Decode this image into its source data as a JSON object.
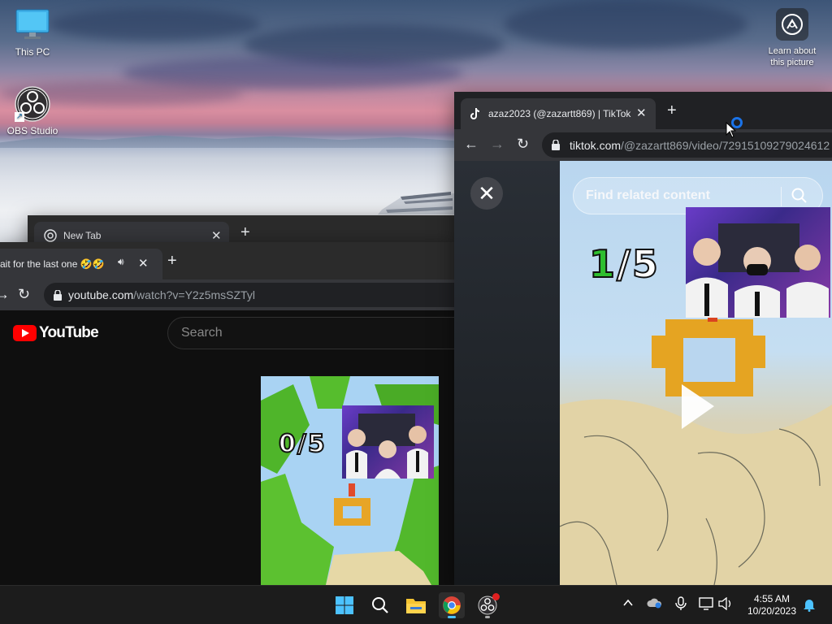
{
  "desktop": {
    "icons": [
      {
        "label": "This PC"
      },
      {
        "label": "OBS Studio"
      }
    ],
    "learn_about": "Learn about this picture"
  },
  "newtab_window": {
    "tab_title": "New Tab"
  },
  "youtube_window": {
    "tab_title": "ait for the last one 🤣🤣",
    "url_host": "youtube.com",
    "url_path": "/watch?v=Y2z5msSZTyl",
    "logo_text": "YouTube",
    "search_placeholder": "Search",
    "video_counter": "0/5"
  },
  "tiktok_window": {
    "tab_title": "azaz2023 (@zazartt869) | TikTok",
    "url_host": "tiktok.com",
    "url_path": "/@zazartt869/video/72915109279024612",
    "search_placeholder": "Find related content",
    "counter_current": "1",
    "counter_total": "/5"
  },
  "taskbar": {
    "apps": [
      "start",
      "search",
      "file-explorer",
      "chrome",
      "obs-studio"
    ],
    "time": "4:55 AM",
    "date": "10/20/2023"
  },
  "colors": {
    "accent": "#4cc2ff",
    "youtube_red": "#ff0000",
    "counter_green": "#2fbf2f"
  }
}
